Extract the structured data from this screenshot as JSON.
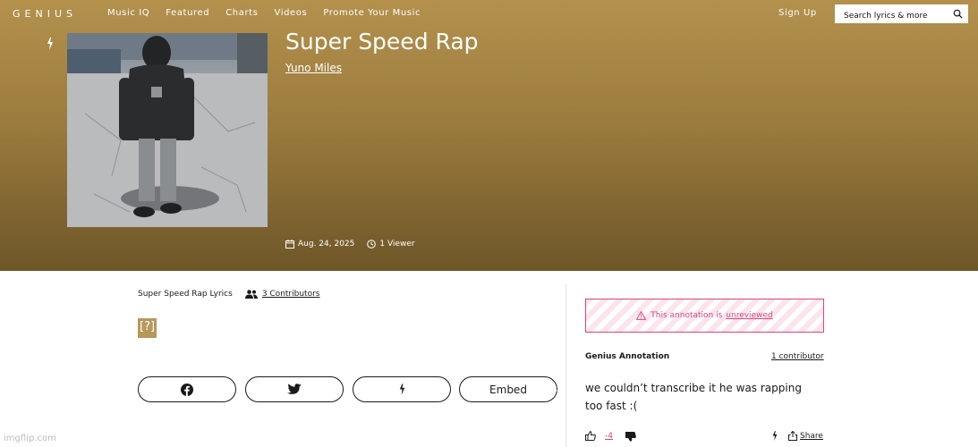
{
  "header": {
    "logo": "GENIUS",
    "nav": [
      "Music IQ",
      "Featured",
      "Charts",
      "Videos",
      "Promote Your Music"
    ],
    "signup": "Sign Up",
    "search_placeholder": "Search lyrics & more"
  },
  "song": {
    "title": "Super Speed Rap",
    "artist": "Yuno Miles",
    "date": "Aug. 24, 2025",
    "viewers": "1 Viewer"
  },
  "lyrics": {
    "heading": "Super Speed Rap Lyrics",
    "contributors": "3 Contributors",
    "body": "[?]"
  },
  "share_buttons": {
    "facebook_icon": "facebook-icon",
    "twitter_icon": "twitter-icon",
    "genius_icon": "bolt-icon",
    "embed": "Embed"
  },
  "annotation": {
    "banner_prefix": "This annotation is",
    "banner_link": "unreviewed",
    "label": "Genius Annotation",
    "contributors": "1 contributor",
    "text": "we couldn’t transcribe it he was rapping too fast :(",
    "score": "-4",
    "share": "Share"
  },
  "colors": {
    "hero_top": "#b3914d",
    "hero_bottom": "#6e5628",
    "accent_pink": "#e0407a",
    "bracket_gold": "#b7975a"
  },
  "watermark": "imgflip.com"
}
